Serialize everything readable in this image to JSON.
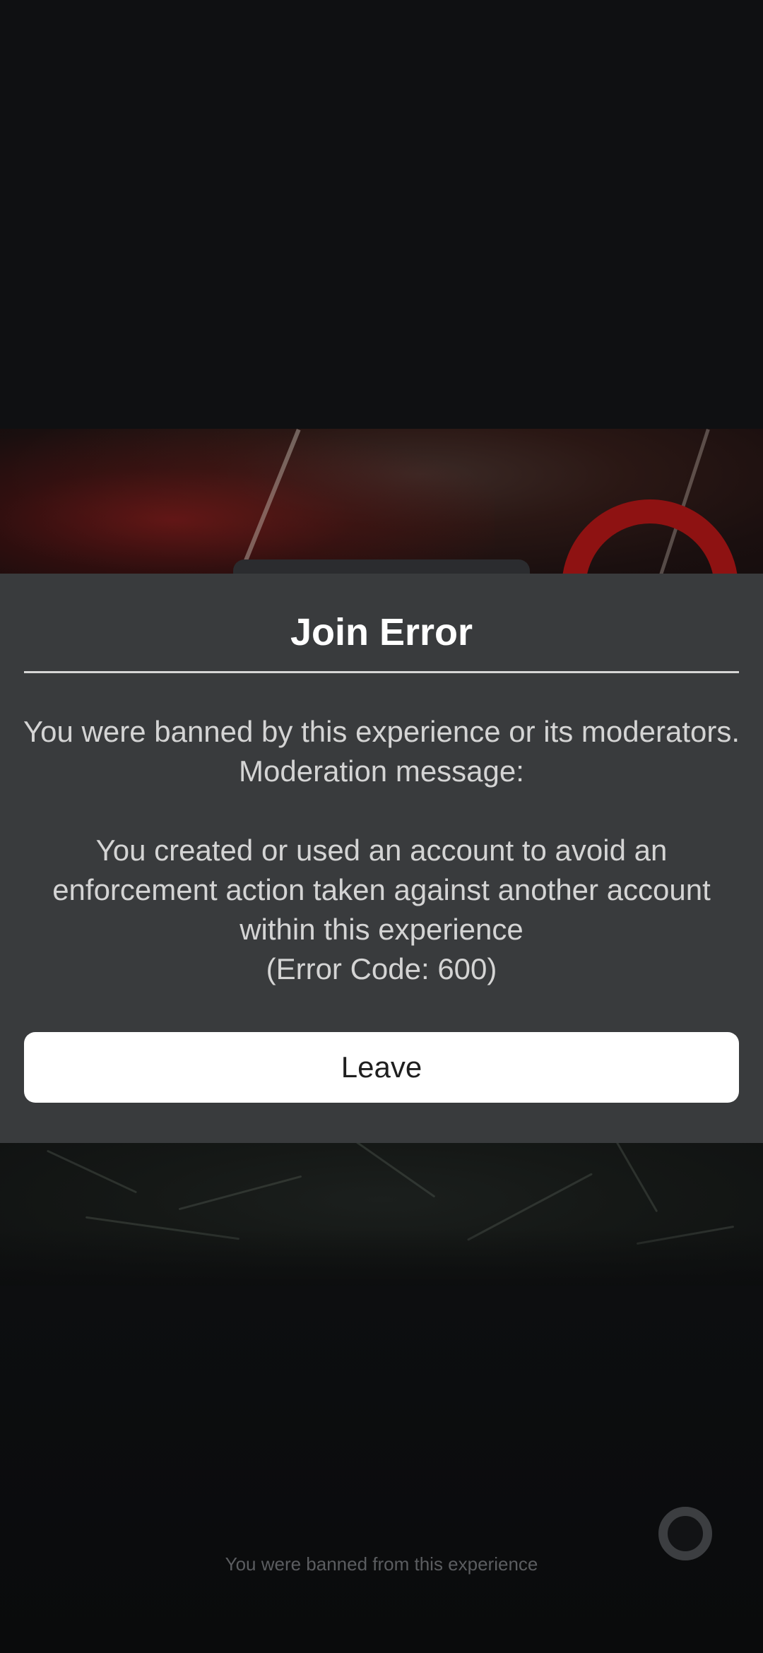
{
  "dialog": {
    "title": "Join Error",
    "message_line_1": "You were banned by this experience or its moderators.",
    "message_line_2": "Moderation message:",
    "moderation_line_1": "You created or used an account to avoid an",
    "moderation_line_2": "enforcement action taken against another account",
    "moderation_line_3": "within this experience",
    "error_code": "(Error Code: 600)",
    "leave_label": "Leave"
  },
  "status": {
    "text": "You were banned from this experience"
  },
  "icons": {
    "spinner": "loading-spinner-icon"
  },
  "colors": {
    "dialog_background": "#393b3d",
    "button_background": "#ffffff",
    "page_background": "#0f1012"
  }
}
